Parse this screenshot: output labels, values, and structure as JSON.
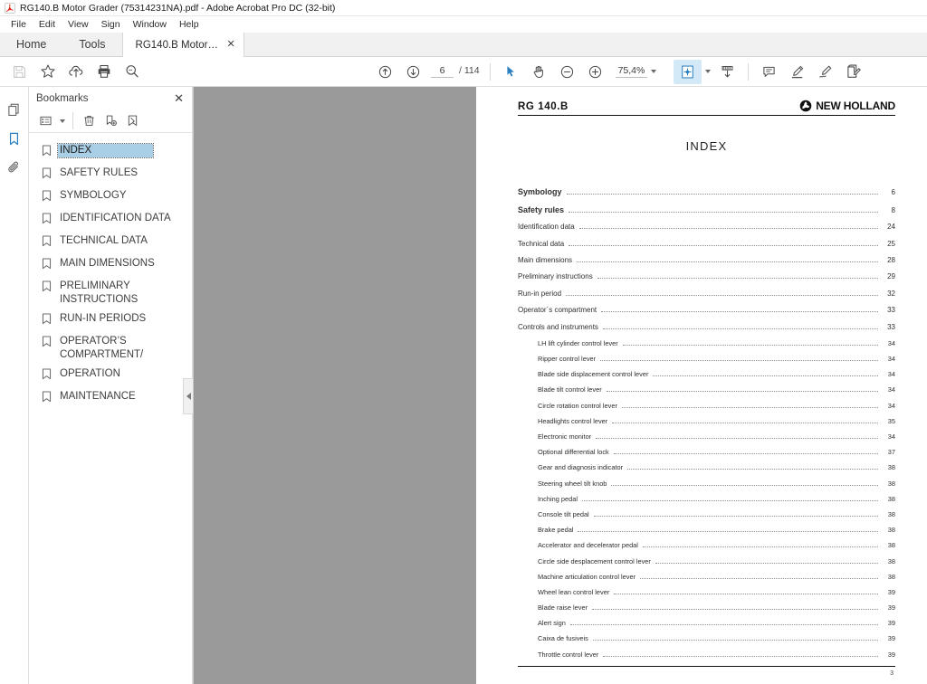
{
  "window": {
    "title": "RG140.B Motor Grader (75314231NA).pdf - Adobe Acrobat Pro DC (32-bit)",
    "app_icon": "acrobat-icon"
  },
  "menubar": {
    "items": [
      {
        "label": "File"
      },
      {
        "label": "Edit"
      },
      {
        "label": "View"
      },
      {
        "label": "Sign"
      },
      {
        "label": "Window"
      },
      {
        "label": "Help"
      }
    ]
  },
  "tabstrip": {
    "home_label": "Home",
    "tools_label": "Tools",
    "document_tab": {
      "label": "RG140.B Motor Gr...",
      "close_label": "✕"
    }
  },
  "toolbar": {
    "left_tools": [
      {
        "name": "save-file-icon",
        "disabled": true
      },
      {
        "name": "add-to-favorites-icon",
        "disabled": false
      },
      {
        "name": "upload-cloud-icon",
        "disabled": false
      },
      {
        "name": "print-icon",
        "disabled": false
      },
      {
        "name": "search-icon",
        "disabled": false
      }
    ],
    "page_prev": "previous-page-icon",
    "page_next": "next-page-icon",
    "page_current": "6",
    "page_total": "/ 114",
    "select_tool": "select-cursor-icon",
    "hand_tool": "hand-tool-icon",
    "zoom_out": "zoom-out-icon",
    "zoom_in": "zoom-in-icon",
    "zoom_level": "75,4%",
    "fit_page": "page-fit-icon",
    "scroll_mode": "scroll-mode-icon",
    "comment": "comment-icon",
    "highlight": "highlight-text-icon",
    "draw": "draw-freehand-icon",
    "fill_sign": "fill-and-sign-icon"
  },
  "rail": {
    "items": [
      {
        "name": "page-thumbnails-icon",
        "active": false
      },
      {
        "name": "bookmarks-icon",
        "active": true
      },
      {
        "name": "attachments-icon",
        "active": false
      }
    ]
  },
  "bookmarks_panel": {
    "title": "Bookmarks",
    "close_label": "✕",
    "tools": [
      {
        "name": "bookmark-options-icon"
      },
      {
        "name": "delete-bookmark-icon"
      },
      {
        "name": "new-bookmark-icon"
      },
      {
        "name": "find-bookmark-icon"
      }
    ],
    "items": [
      {
        "label": "INDEX",
        "selected": true
      },
      {
        "label": "SAFETY RULES",
        "selected": false
      },
      {
        "label": "SYMBOLOGY",
        "selected": false
      },
      {
        "label": "IDENTIFICATION DATA",
        "selected": false
      },
      {
        "label": "TECHNICAL DATA",
        "selected": false
      },
      {
        "label": "MAIN DIMENSIONS",
        "selected": false
      },
      {
        "label": "PRELIMINARY INSTRUCTIONS",
        "selected": false
      },
      {
        "label": "RUN-IN PERIODS",
        "selected": false
      },
      {
        "label": "OPERATOR’S COMPARTMENT/",
        "selected": false
      },
      {
        "label": "OPERATION",
        "selected": false
      },
      {
        "label": "MAINTENANCE",
        "selected": false
      }
    ]
  },
  "document": {
    "model": "RG 140.B",
    "brand": "NEW HOLLAND",
    "title": "INDEX",
    "folio": "3",
    "toc": [
      {
        "label": "Symbology",
        "page": "6",
        "level": 0,
        "bold": true
      },
      {
        "label": "Safety  rules",
        "page": "8",
        "level": 0,
        "bold": true
      },
      {
        "label": "Identification data",
        "page": "24",
        "level": 0,
        "bold": false
      },
      {
        "label": "Technical data",
        "page": "25",
        "level": 0,
        "bold": false
      },
      {
        "label": "Main dimensions",
        "page": "28",
        "level": 0,
        "bold": false
      },
      {
        "label": "Preliminary instructions",
        "page": "29",
        "level": 0,
        "bold": false
      },
      {
        "label": "Run-in period",
        "page": "32",
        "level": 0,
        "bold": false
      },
      {
        "label": "Operator´s compartment",
        "page": "33",
        "level": 0,
        "bold": false
      },
      {
        "label": "Controls and instruments",
        "page": "33",
        "level": 0,
        "bold": false
      },
      {
        "label": "LH lift cylinder control lever",
        "page": "34",
        "level": 1,
        "bold": false
      },
      {
        "label": "Ripper control lever",
        "page": "34",
        "level": 1,
        "bold": false
      },
      {
        "label": "Blade side displacement control lever",
        "page": "34",
        "level": 1,
        "bold": false
      },
      {
        "label": "Blade tilt control lever",
        "page": "34",
        "level": 1,
        "bold": false
      },
      {
        "label": "Circle rotation control lever",
        "page": "34",
        "level": 1,
        "bold": false
      },
      {
        "label": "Headlights control lever",
        "page": "35",
        "level": 1,
        "bold": false
      },
      {
        "label": "Electronic monitor",
        "page": "34",
        "level": 1,
        "bold": false
      },
      {
        "label": "Optional differential lock",
        "page": "37",
        "level": 1,
        "bold": false
      },
      {
        "label": "Gear and diagnosis indicator",
        "page": "38",
        "level": 1,
        "bold": false
      },
      {
        "label": "Steering wheel tilt knob",
        "page": "38",
        "level": 1,
        "bold": false
      },
      {
        "label": "Inching pedal",
        "page": "38",
        "level": 1,
        "bold": false
      },
      {
        "label": "Console tilt pedal",
        "page": "38",
        "level": 1,
        "bold": false
      },
      {
        "label": "Brake pedal",
        "page": "38",
        "level": 1,
        "bold": false
      },
      {
        "label": "Accelerator and decelerator pedal",
        "page": "38",
        "level": 1,
        "bold": false
      },
      {
        "label": "Circle side desplacement control lever",
        "page": "38",
        "level": 1,
        "bold": false
      },
      {
        "label": "Machine articulation control lever",
        "page": "38",
        "level": 1,
        "bold": false
      },
      {
        "label": "Wheel lean control lever",
        "page": "39",
        "level": 1,
        "bold": false
      },
      {
        "label": "Blade raise lever",
        "page": "39",
        "level": 1,
        "bold": false
      },
      {
        "label": "Alert sign",
        "page": "39",
        "level": 1,
        "bold": false
      },
      {
        "label": "Caixa de fusiveis",
        "page": "39",
        "level": 1,
        "bold": false
      },
      {
        "label": "Throttle control lever",
        "page": "39",
        "level": 1,
        "bold": false
      }
    ]
  },
  "colors": {
    "accent_blue": "#2a7fc0",
    "selection_blue": "#a8cfe5",
    "canvas_grey": "#9a9a9a",
    "tab_grey": "#f1f1f1"
  }
}
